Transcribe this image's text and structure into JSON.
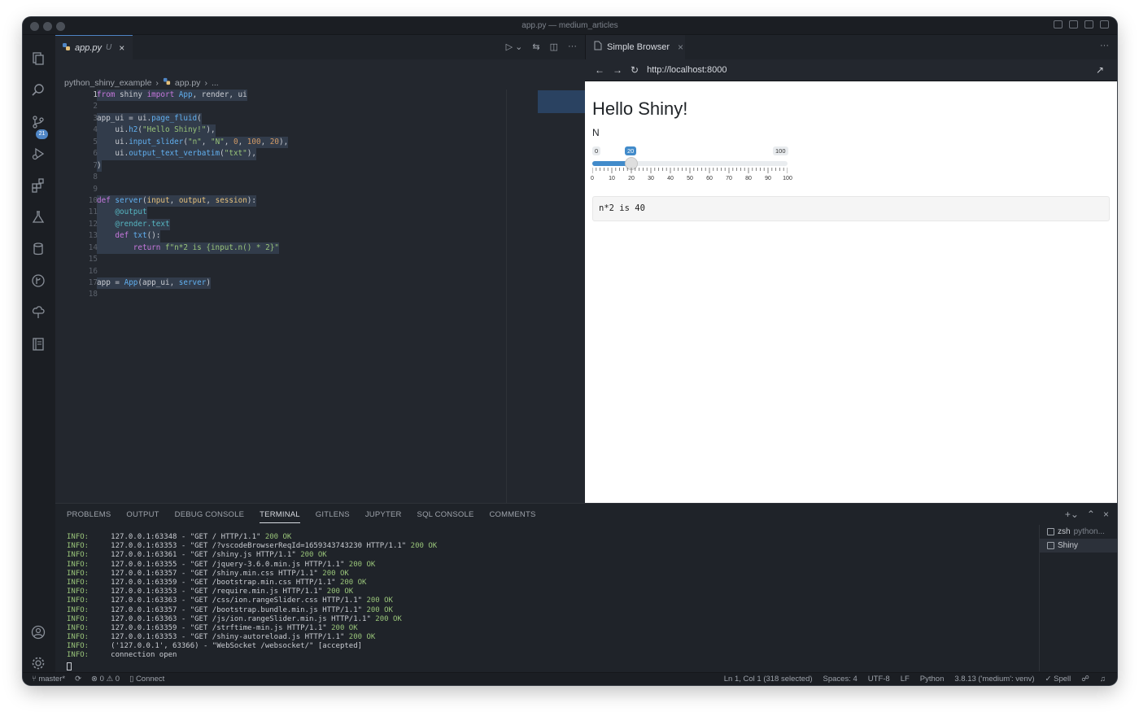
{
  "window": {
    "title": "app.py — medium_articles"
  },
  "activity_bar": {
    "icons": [
      "files-icon",
      "search-icon",
      "source-control-icon",
      "run-debug-icon",
      "extensions-icon",
      "testing-icon",
      "database-icon",
      "git-graph-icon",
      "tree-icon",
      "notebook-icon",
      "account-icon",
      "settings-gear-icon"
    ],
    "source_control_badge": "21"
  },
  "editor": {
    "tab": {
      "label": "app.py",
      "status": "U"
    },
    "breadcrumb": {
      "folder": "python_shiny_example",
      "file": "app.py",
      "more": "..."
    },
    "lines": [
      {
        "n": "1",
        "text": "from shiny import App, render, ui"
      },
      {
        "n": "2",
        "text": ""
      },
      {
        "n": "3",
        "text": "app_ui = ui.page_fluid("
      },
      {
        "n": "4",
        "text": "    ui.h2(\"Hello Shiny!\"),"
      },
      {
        "n": "5",
        "text": "    ui.input_slider(\"n\", \"N\", 0, 100, 20),"
      },
      {
        "n": "6",
        "text": "    ui.output_text_verbatim(\"txt\"),"
      },
      {
        "n": "7",
        "text": ")"
      },
      {
        "n": "8",
        "text": ""
      },
      {
        "n": "9",
        "text": ""
      },
      {
        "n": "10",
        "text": "def server(input, output, session):"
      },
      {
        "n": "11",
        "text": "    @output"
      },
      {
        "n": "12",
        "text": "    @render.text"
      },
      {
        "n": "13",
        "text": "    def txt():"
      },
      {
        "n": "14",
        "text": "        return f\"n*2 is {input.n() * 2}\""
      },
      {
        "n": "15",
        "text": ""
      },
      {
        "n": "16",
        "text": ""
      },
      {
        "n": "17",
        "text": "app = App(app_ui, server)"
      },
      {
        "n": "18",
        "text": ""
      }
    ]
  },
  "browser": {
    "tab_label": "Simple Browser",
    "url": "http://localhost:8000",
    "heading": "Hello Shiny!",
    "slider": {
      "label": "N",
      "min": "0",
      "max": "100",
      "value": "20",
      "value_fraction": 0.2,
      "tick_labels": [
        "0",
        "10",
        "20",
        "30",
        "40",
        "50",
        "60",
        "70",
        "80",
        "90",
        "100"
      ]
    },
    "output_text": "n*2 is 40"
  },
  "panel": {
    "tabs": [
      "PROBLEMS",
      "OUTPUT",
      "DEBUG CONSOLE",
      "TERMINAL",
      "GITLENS",
      "JUPYTER",
      "SQL CONSOLE",
      "COMMENTS"
    ],
    "active_tab": "TERMINAL",
    "terminal_lines": [
      {
        "prefix": "INFO:",
        "text": "127.0.0.1:63348 - \"GET / HTTP/1.1\"",
        "status": "200 OK"
      },
      {
        "prefix": "INFO:",
        "text": "127.0.0.1:63353 - \"GET /?vscodeBrowserReqId=1659343743230 HTTP/1.1\"",
        "status": "200 OK"
      },
      {
        "prefix": "INFO:",
        "text": "127.0.0.1:63361 - \"GET /shiny.js HTTP/1.1\"",
        "status": "200 OK"
      },
      {
        "prefix": "INFO:",
        "text": "127.0.0.1:63355 - \"GET /jquery-3.6.0.min.js HTTP/1.1\"",
        "status": "200 OK"
      },
      {
        "prefix": "INFO:",
        "text": "127.0.0.1:63357 - \"GET /shiny.min.css HTTP/1.1\"",
        "status": "200 OK"
      },
      {
        "prefix": "INFO:",
        "text": "127.0.0.1:63359 - \"GET /bootstrap.min.css HTTP/1.1\"",
        "status": "200 OK"
      },
      {
        "prefix": "INFO:",
        "text": "127.0.0.1:63353 - \"GET /require.min.js HTTP/1.1\"",
        "status": "200 OK"
      },
      {
        "prefix": "INFO:",
        "text": "127.0.0.1:63363 - \"GET /css/ion.rangeSlider.css HTTP/1.1\"",
        "status": "200 OK"
      },
      {
        "prefix": "INFO:",
        "text": "127.0.0.1:63357 - \"GET /bootstrap.bundle.min.js HTTP/1.1\"",
        "status": "200 OK"
      },
      {
        "prefix": "INFO:",
        "text": "127.0.0.1:63363 - \"GET /js/ion.rangeSlider.min.js HTTP/1.1\"",
        "status": "200 OK"
      },
      {
        "prefix": "INFO:",
        "text": "127.0.0.1:63359 - \"GET /strftime-min.js HTTP/1.1\"",
        "status": "200 OK"
      },
      {
        "prefix": "INFO:",
        "text": "127.0.0.1:63353 - \"GET /shiny-autoreload.js HTTP/1.1\"",
        "status": "200 OK"
      },
      {
        "prefix": "INFO:",
        "text": "('127.0.0.1', 63366) - \"WebSocket /websocket/\" [accepted]",
        "status": ""
      },
      {
        "prefix": "INFO:",
        "text": "connection open",
        "status": ""
      }
    ],
    "terminals": [
      {
        "name": "zsh",
        "sub": "python..."
      },
      {
        "name": "Shiny",
        "sub": ""
      }
    ]
  },
  "status_bar": {
    "branch": "master*",
    "errors": "0",
    "warnings": "0",
    "connect": "Connect",
    "position": "Ln 1, Col 1 (318 selected)",
    "spaces": "Spaces: 4",
    "encoding": "UTF-8",
    "eol": "LF",
    "language": "Python",
    "interpreter": "3.8.13 ('medium': venv)",
    "spell": "Spell"
  },
  "colors": {
    "accent": "#4f86c6",
    "editor_bg": "#23272e",
    "slider_fill": "#428bca",
    "ok_green": "#98c379"
  }
}
